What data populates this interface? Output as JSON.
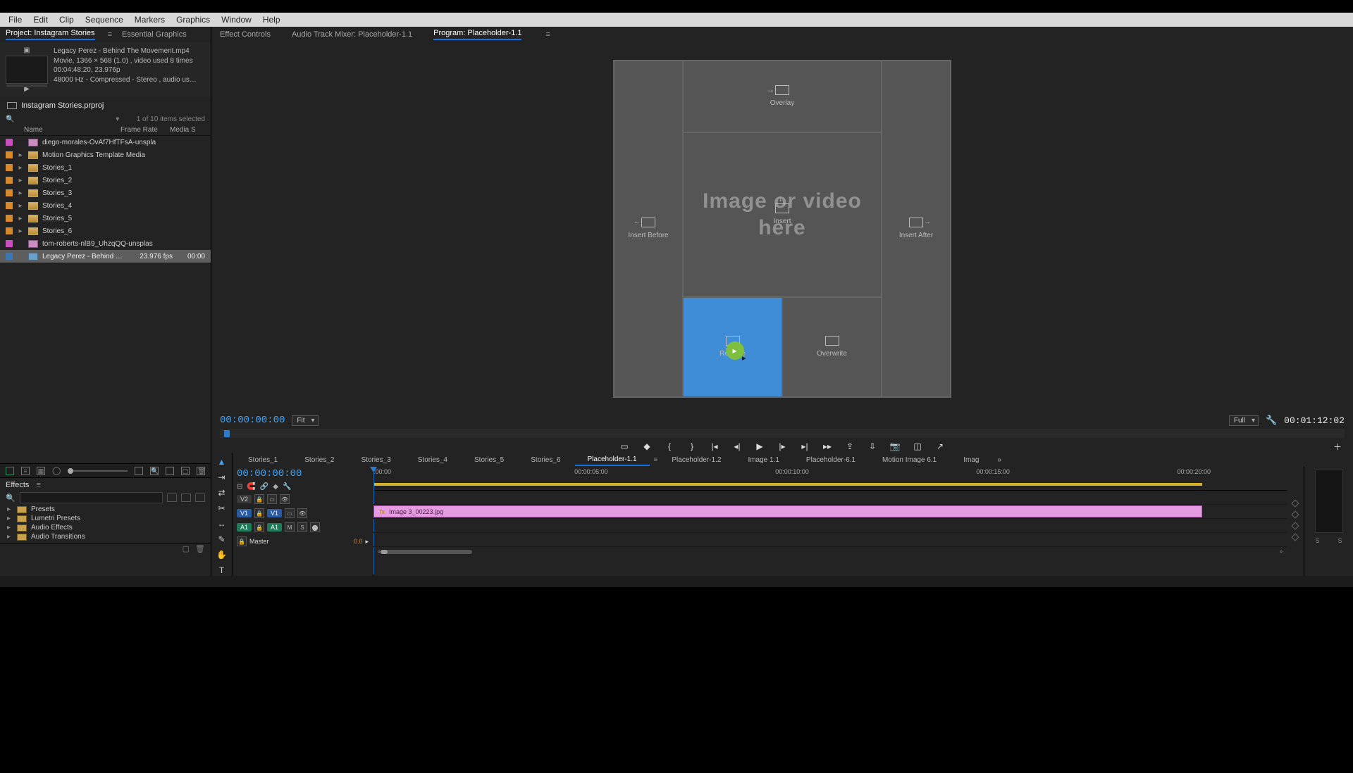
{
  "menu": [
    "File",
    "Edit",
    "Clip",
    "Sequence",
    "Markers",
    "Graphics",
    "Window",
    "Help"
  ],
  "source_tabs": {
    "project_label": "Project: Instagram Stories",
    "essential_label": "Essential Graphics"
  },
  "clip_info": {
    "filename": "Legacy Perez - Behind The Movement.mp4",
    "line2": "Movie, 1366 × 568 (1.0)    , video used 8 times",
    "line3": "00:04:48:20, 23.976p",
    "line4": "48000 Hz - Compressed - Stereo    , audio us…"
  },
  "project_file": "Instagram Stories.prproj",
  "selection_status": "1 of 10 items selected",
  "columns": {
    "name": "Name",
    "frame_rate": "Frame Rate",
    "media_start": "Media S"
  },
  "bins": [
    {
      "swatch": "sw-pink",
      "tw": "",
      "kind": "img",
      "name": "diego-morales-OvAf7HfTFsA-unspla",
      "fr": "",
      "ms": ""
    },
    {
      "swatch": "sw-orange",
      "tw": "▸",
      "kind": "folder",
      "name": "Motion Graphics Template Media",
      "fr": "",
      "ms": ""
    },
    {
      "swatch": "sw-orange",
      "tw": "▸",
      "kind": "folder",
      "name": "Stories_1",
      "fr": "",
      "ms": ""
    },
    {
      "swatch": "sw-orange",
      "tw": "▸",
      "kind": "folder",
      "name": "Stories_2",
      "fr": "",
      "ms": ""
    },
    {
      "swatch": "sw-orange",
      "tw": "▸",
      "kind": "folder",
      "name": "Stories_3",
      "fr": "",
      "ms": ""
    },
    {
      "swatch": "sw-orange",
      "tw": "▸",
      "kind": "folder",
      "name": "Stories_4",
      "fr": "",
      "ms": ""
    },
    {
      "swatch": "sw-orange",
      "tw": "▸",
      "kind": "folder",
      "name": "Stories_5",
      "fr": "",
      "ms": ""
    },
    {
      "swatch": "sw-orange",
      "tw": "▸",
      "kind": "folder",
      "name": "Stories_6",
      "fr": "",
      "ms": ""
    },
    {
      "swatch": "sw-pink",
      "tw": "",
      "kind": "img",
      "name": "tom-roberts-nlB9_UhzqQQ-unsplas",
      "fr": "",
      "ms": ""
    },
    {
      "swatch": "sw-blue",
      "tw": "",
      "kind": "clip",
      "name": "Legacy Perez - Behind The Moveme",
      "fr": "23.976 fps",
      "ms": "00:00",
      "sel": true
    }
  ],
  "effects": {
    "title": "Effects",
    "folders": [
      "Presets",
      "Lumetri Presets",
      "Audio Effects",
      "Audio Transitions"
    ]
  },
  "monitor_tabs": {
    "effect_controls": "Effect Controls",
    "audio_mixer": "Audio Track Mixer: Placeholder-1.1",
    "program": "Program: Placeholder-1.1"
  },
  "dropzones": {
    "overlay": "Overlay",
    "insert": "Insert",
    "insert_before": "Insert Before",
    "insert_after": "Insert After",
    "replace": "Replace",
    "overwrite": "Overwrite"
  },
  "placeholder_text_1": "Image or video",
  "placeholder_text_2": "here",
  "transport": {
    "tc_left": "00:00:00:00",
    "fit": "Fit",
    "full": "Full",
    "tc_right": "00:01:12:02"
  },
  "seq_tabs": [
    "Stories_1",
    "Stories_2",
    "Stories_3",
    "Stories_4",
    "Stories_5",
    "Stories_6",
    "Placeholder-1.1",
    "Placeholder-1.2",
    "Image 1.1",
    "Placeholder-6.1",
    "Motion Image 6.1",
    "Imag"
  ],
  "seq_active_index": 6,
  "timeline": {
    "tc": "00:00:00:00",
    "ticks": [
      ":00:00",
      "00:00:05:00",
      "00:00:10:00",
      "00:00:15:00",
      "00:00:20:00"
    ],
    "v2": "V2",
    "v1": "V1",
    "a1": "A1",
    "master": "Master",
    "master_val": "0.0",
    "clip_name": "Image 3_00223.jpg",
    "solo_labels": [
      "S",
      "S"
    ]
  }
}
